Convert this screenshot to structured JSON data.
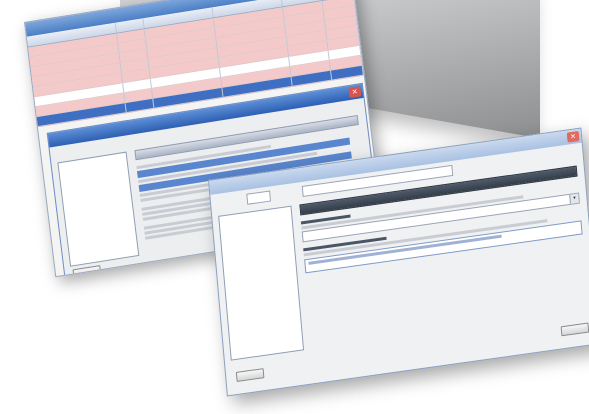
{
  "window_back": {
    "grid_rows": [
      {
        "style": "red"
      },
      {
        "style": "red"
      },
      {
        "style": "red"
      },
      {
        "style": "red"
      },
      {
        "style": "red"
      },
      {
        "style": "white"
      },
      {
        "style": "red"
      },
      {
        "style": "selected"
      }
    ]
  },
  "colors": {
    "row_alert": "#f4c9c9",
    "row_selected": "#3f6fc2",
    "titlebar": "#4b7fc5"
  }
}
